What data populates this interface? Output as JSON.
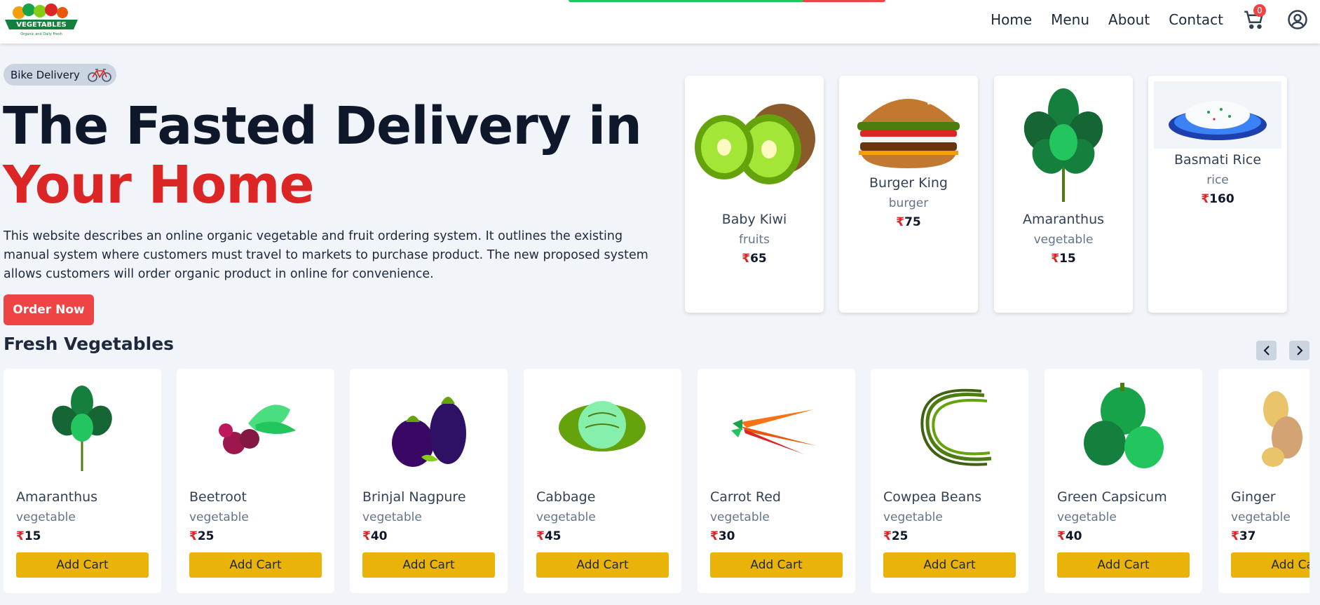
{
  "header": {
    "logo_text": "VEGETABLES",
    "logo_tagline": "Organic and Daily Fresh",
    "nav": [
      "Home",
      "Menu",
      "About",
      "Contact"
    ],
    "cart_count": "0"
  },
  "hero": {
    "pill_label": "Bike Delivery",
    "title_line1": "The Fasted Delivery in",
    "title_line2": "Your Home",
    "description": "This website describes an online organic vegetable and fruit ordering system. It outlines the existing manual system where customers must travel to markets to purchase product. The new proposed system allows customers will order organic product in online for convenience.",
    "order_button": "Order Now"
  },
  "currency": "₹",
  "showcase": [
    {
      "name": "Baby Kiwi",
      "category": "fruits",
      "price": "65",
      "icon": "kiwi-image"
    },
    {
      "name": "Burger King",
      "category": "burger",
      "price": "75",
      "icon": "burger-image"
    },
    {
      "name": "Amaranthus",
      "category": "vegetable",
      "price": "15",
      "icon": "amaranthus-image"
    },
    {
      "name": "Basmati Rice",
      "category": "rice",
      "price": "160",
      "icon": "rice-image"
    }
  ],
  "fresh": {
    "title": "Fresh Vegetables",
    "add_label": "Add Cart",
    "items": [
      {
        "name": "Amaranthus",
        "category": "vegetable",
        "price": "15"
      },
      {
        "name": "Beetroot",
        "category": "vegetable",
        "price": "25"
      },
      {
        "name": "Brinjal Nagpure",
        "category": "vegetable",
        "price": "40"
      },
      {
        "name": "Cabbage",
        "category": "vegetable",
        "price": "45"
      },
      {
        "name": "Carrot Red",
        "category": "vegetable",
        "price": "30"
      },
      {
        "name": "Cowpea Beans",
        "category": "vegetable",
        "price": "25"
      },
      {
        "name": "Green Capsicum",
        "category": "vegetable",
        "price": "40"
      },
      {
        "name": "Ginger",
        "category": "vegetable",
        "price": "37"
      }
    ]
  },
  "colors": {
    "accent_red": "#ef4444",
    "add_cart_yellow": "#eab308",
    "progress_green": "#22c55e"
  }
}
